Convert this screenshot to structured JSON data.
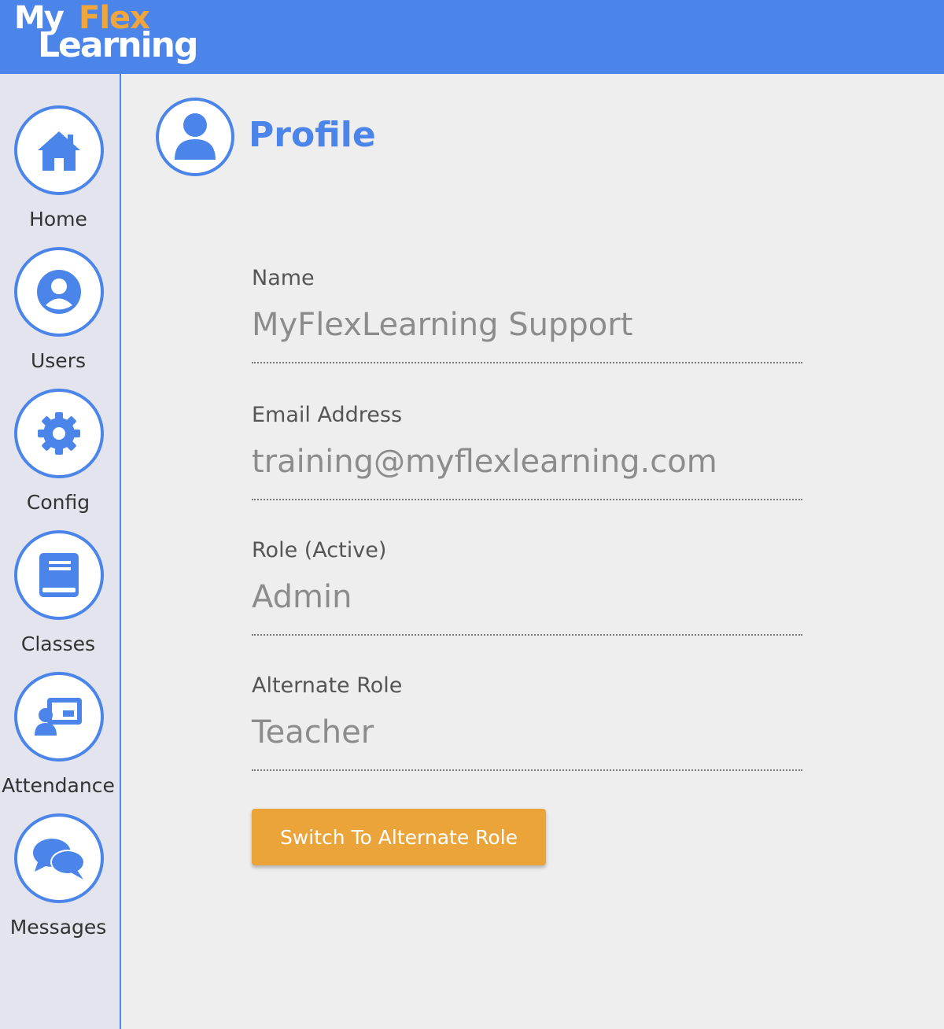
{
  "brand": {
    "logo_my": "My",
    "logo_flex": "Flex",
    "logo_learning": "Learning"
  },
  "colors": {
    "accent": "#4c85ea",
    "logo_orange": "#f0a63a",
    "button": "#eba43a"
  },
  "sidebar": {
    "items": [
      {
        "label": "Home",
        "icon": "home-icon"
      },
      {
        "label": "Users",
        "icon": "user-circle-icon"
      },
      {
        "label": "Config",
        "icon": "gear-icon"
      },
      {
        "label": "Classes",
        "icon": "book-icon"
      },
      {
        "label": "Attendance",
        "icon": "presentation-icon"
      },
      {
        "label": "Messages",
        "icon": "chat-bubbles-icon"
      }
    ]
  },
  "page": {
    "title": "Profile",
    "icon": "user-icon"
  },
  "fields": [
    {
      "label": "Name",
      "value": "MyFlexLearning Support"
    },
    {
      "label": "Email Address",
      "value": "training@myflexlearning.com"
    },
    {
      "label": "Role (Active)",
      "value": "Admin"
    },
    {
      "label": "Alternate Role",
      "value": "Teacher"
    }
  ],
  "actions": {
    "switch_role_label": "Switch To Alternate Role"
  }
}
